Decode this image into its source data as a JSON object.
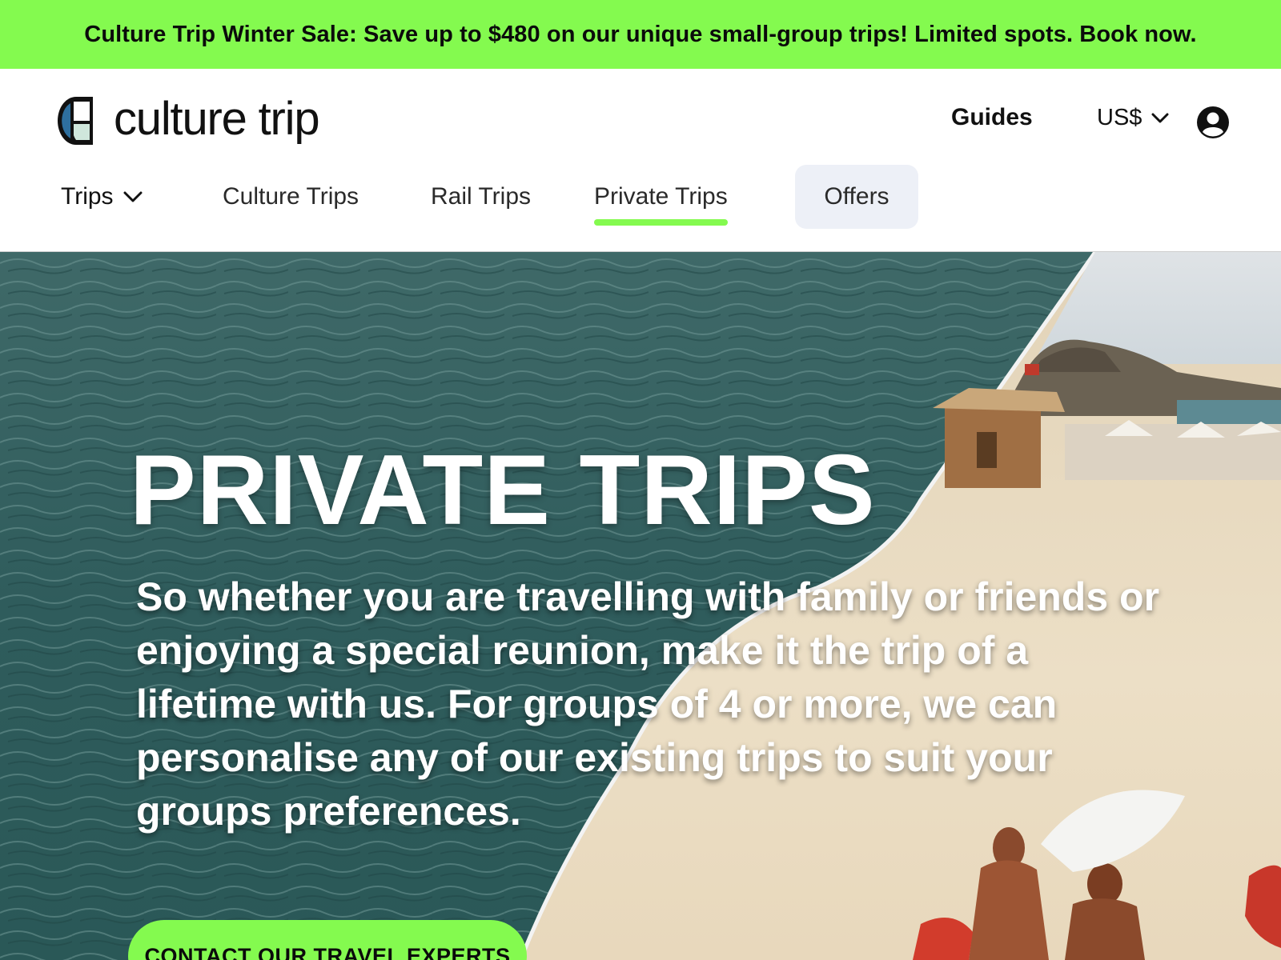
{
  "promo": {
    "text": "Culture Trip Winter Sale: Save up to $480 on our unique small-group trips! Limited spots. Book now."
  },
  "header": {
    "logo_text": "culture trip",
    "guides_label": "Guides",
    "currency_label": "US$"
  },
  "nav": {
    "items": [
      {
        "label": "Trips"
      },
      {
        "label": "Culture Trips"
      },
      {
        "label": "Rail Trips"
      },
      {
        "label": "Private Trips"
      },
      {
        "label": "Offers"
      }
    ],
    "active": "Private Trips"
  },
  "hero": {
    "title": "PRIVATE TRIPS",
    "body": "So whether you are travelling with family or friends or enjoying a special reunion, make it the trip of a lifetime with us. For groups of 4 or more, we can personalise any of our existing trips to suit your groups preferences.",
    "cta_label": "CONTACT OUR TRAVEL EXPERTS"
  },
  "colors": {
    "accent": "#84fa4f",
    "offers_bg": "#edf0f7",
    "text": "#111111"
  },
  "icons": [
    "culture-trip-logo-icon",
    "chevron-down-icon",
    "account-icon"
  ]
}
